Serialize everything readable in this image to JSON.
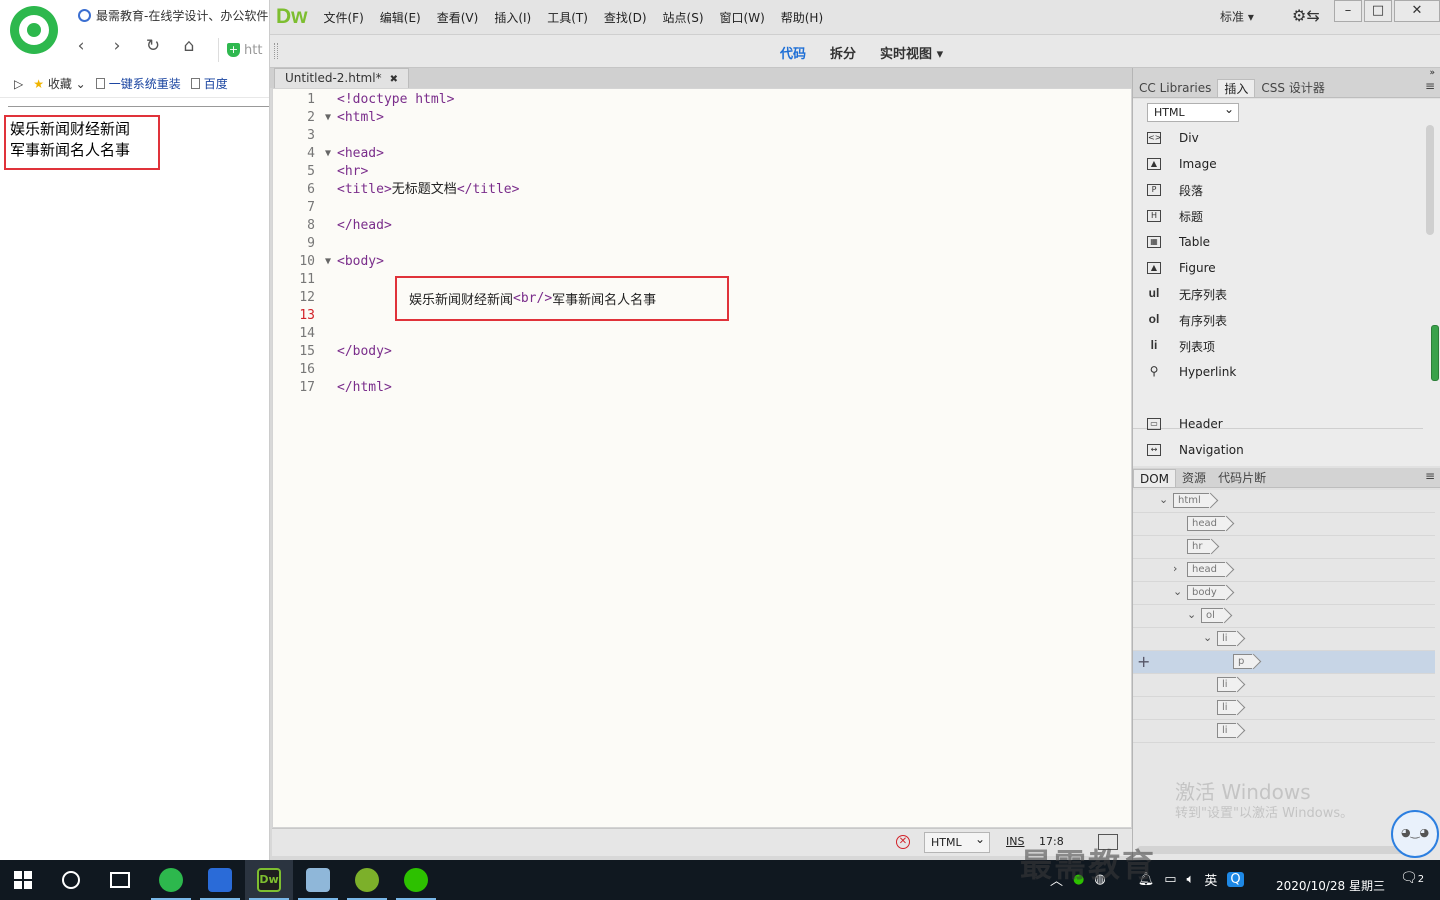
{
  "browser": {
    "tab_title": "最需教育-在线学设计、办公软件",
    "address_prefix": "htt",
    "bookmarks": {
      "favorites_label": "收藏",
      "items": [
        "一键系统重装",
        "百度"
      ]
    },
    "page_content": {
      "line1": "娱乐新闻财经新闻",
      "line2": "军事新闻名人名事"
    }
  },
  "dw": {
    "logo": "Dw",
    "menu": [
      "文件(F)",
      "编辑(E)",
      "查看(V)",
      "插入(I)",
      "工具(T)",
      "查找(D)",
      "站点(S)",
      "窗口(W)",
      "帮助(H)"
    ],
    "workspace": "标准",
    "view_buttons": {
      "code": "代码",
      "split": "拆分",
      "live": "实时视图"
    },
    "doc_tab": "Untitled-2.html*",
    "editor": {
      "line_numbers": [
        "1",
        "2",
        "3",
        "4",
        "5",
        "6",
        "7",
        "8",
        "9",
        "10",
        "11",
        "12",
        "13",
        "14",
        "15",
        "16",
        "17"
      ],
      "current_line": "13",
      "lines": {
        "l1": "<!doctype html>",
        "l2": "<html>",
        "l4": "<head>",
        "l5": "<hr>",
        "l6_open": "<title>",
        "l6_text": "无标题文档",
        "l6_close": "</title>",
        "l8": "</head>",
        "l10": "<body>",
        "l15": "</body>",
        "l17": "</html>"
      },
      "body_text_1": "娱乐新闻财经新闻",
      "body_tag": "<br/>",
      "body_text_2": "军事新闻名人名事"
    },
    "status": {
      "language": "HTML",
      "mode": "INS",
      "position": "17:8"
    },
    "panels": {
      "top_tabs": [
        "CC Libraries",
        "插入",
        "CSS 设计器"
      ],
      "insert_category": "HTML",
      "insert_items": [
        {
          "label": "Div",
          "icon": "div-icon"
        },
        {
          "label": "Image",
          "icon": "image-icon"
        },
        {
          "label": "段落",
          "icon": "paragraph-icon"
        },
        {
          "label": "标题",
          "icon": "heading-icon"
        },
        {
          "label": "Table",
          "icon": "table-icon"
        },
        {
          "label": "Figure",
          "icon": "figure-icon"
        },
        {
          "label": "无序列表",
          "icon": "ul",
          "text_icon": "ul"
        },
        {
          "label": "有序列表",
          "icon": "ol",
          "text_icon": "ol"
        },
        {
          "label": "列表项",
          "icon": "li",
          "text_icon": "li"
        },
        {
          "label": "Hyperlink",
          "icon": "hyperlink-icon"
        },
        {
          "label": "Header",
          "icon": "header-icon"
        },
        {
          "label": "Navigation",
          "icon": "navigation-icon"
        }
      ],
      "bottom_tabs": [
        "DOM",
        "资源",
        "代码片断"
      ],
      "dom_tree": [
        "html",
        "head",
        "hr",
        "head",
        "body",
        "ol",
        "li",
        "p",
        "li",
        "li",
        "li"
      ],
      "watermark_title": "激活 Windows",
      "watermark_sub": "转到\"设置\"以激活 Windows。"
    }
  },
  "taskbar": {
    "ime": "英",
    "date": "2020/10/28 星期三",
    "notify_count": "2"
  },
  "brand_watermark": "最需教育",
  "colors": {
    "highlight_red": "#e0323a",
    "dw_green": "#7dbe30",
    "active_view_blue": "#1e6fd6",
    "tag_purple": "#7a2d8b"
  }
}
